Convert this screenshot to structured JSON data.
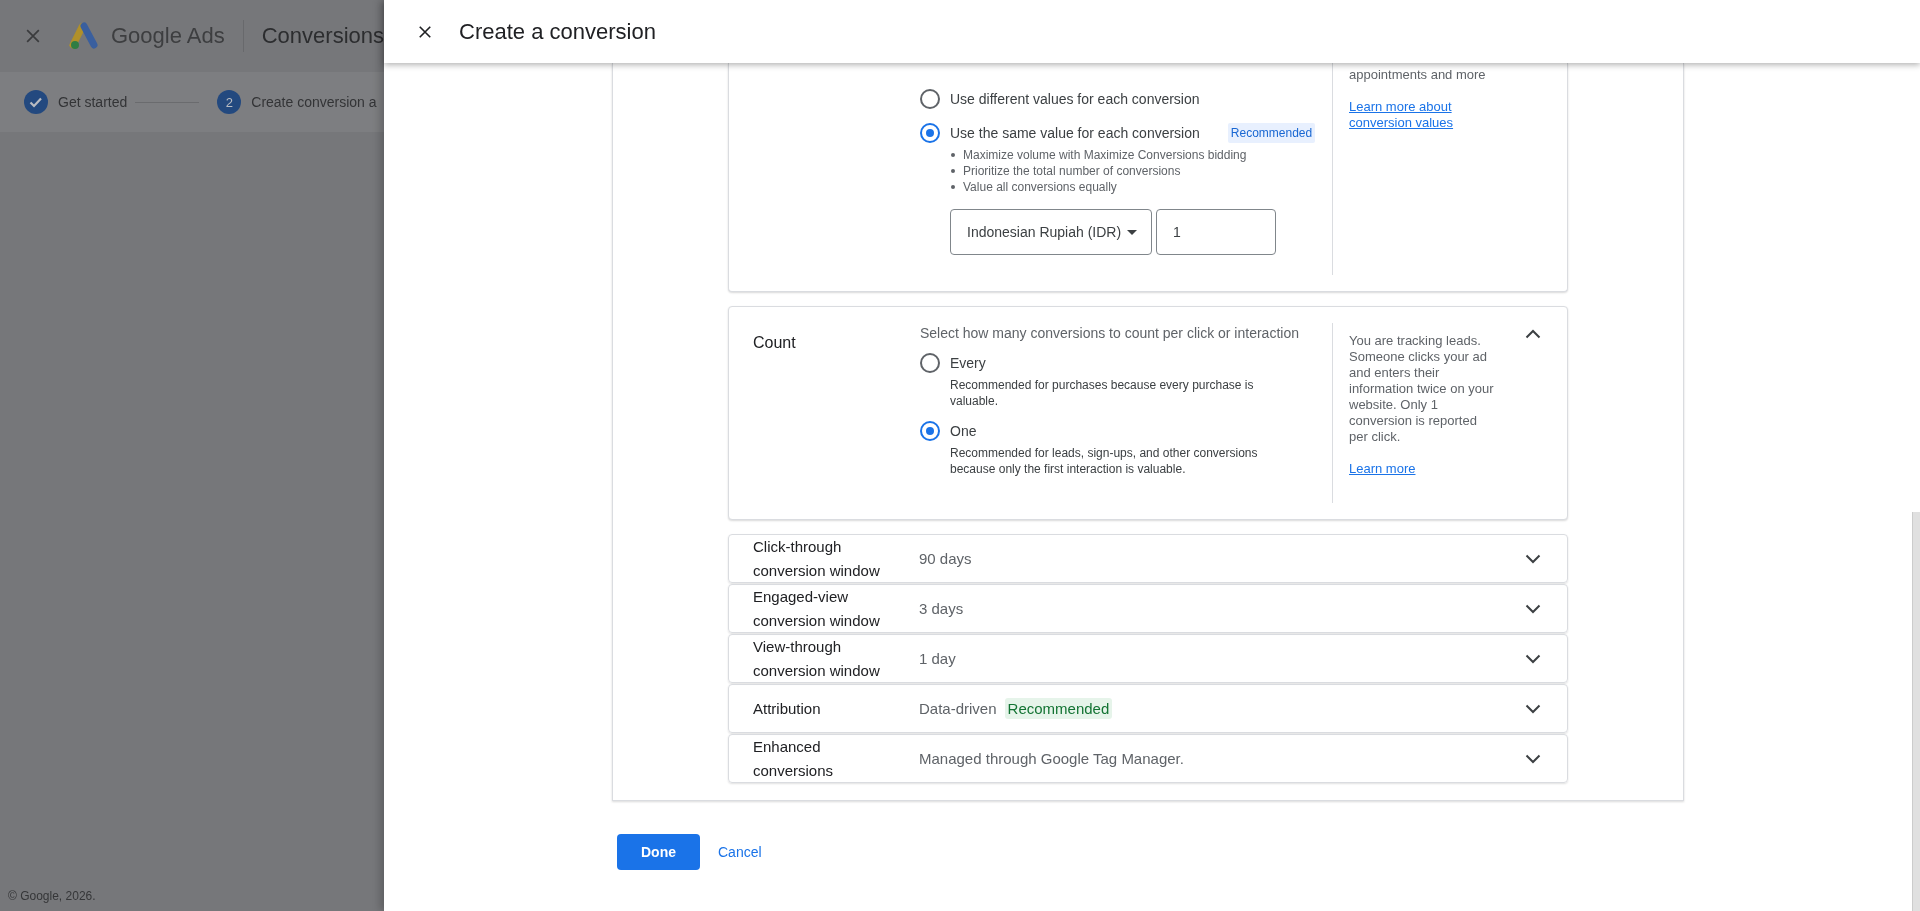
{
  "backdrop": {
    "app_name": "Google Ads",
    "page_title": "Conversions",
    "steps": [
      {
        "label": "Get started",
        "done": true
      },
      {
        "number": "2",
        "label": "Create conversion a",
        "done": false
      }
    ],
    "footer": "© Google, 2026."
  },
  "dialog": {
    "title": "Create a conversion"
  },
  "value_section": {
    "options": [
      {
        "label": "Use different values for each conversion",
        "selected": false
      },
      {
        "label": "Use the same value for each conversion",
        "selected": true,
        "badge": "Recommended",
        "bullets": [
          "Maximize volume with Maximize Conversions bidding",
          "Prioritize the total number of conversions",
          "Value all conversions equally"
        ]
      }
    ],
    "currency": "Indonesian Rupiah (IDR)",
    "amount": "1",
    "help": "appointments and more",
    "link": "Learn more about conversion values"
  },
  "count_section": {
    "title": "Count",
    "description": "Select how many conversions to count per click or interaction",
    "expanded": true,
    "options": [
      {
        "label": "Every",
        "detail": "Recommended for purchases because every purchase is valuable.",
        "selected": false
      },
      {
        "label": "One",
        "detail": "Recommended for leads, sign-ups, and other conversions because only the first interaction is valuable.",
        "selected": true
      }
    ],
    "help": "You are tracking leads. Someone clicks your ad and enters their information twice on your website. Only 1 conversion is reported per click.",
    "link": "Learn more"
  },
  "settings": [
    {
      "label": "Click-through conversion window",
      "value": "90 days",
      "expanded": false
    },
    {
      "label": "Engaged-view conversion window",
      "value": "3 days",
      "expanded": false
    },
    {
      "label": "View-through conversion window",
      "value": "1 day",
      "expanded": false
    },
    {
      "label": "Attribution",
      "value": "Data-driven",
      "badge": "Recommended",
      "expanded": false
    },
    {
      "label": "Enhanced conversions",
      "value": "Managed through Google Tag Manager.",
      "expanded": false
    }
  ],
  "buttons": {
    "done": "Done",
    "cancel": "Cancel"
  }
}
